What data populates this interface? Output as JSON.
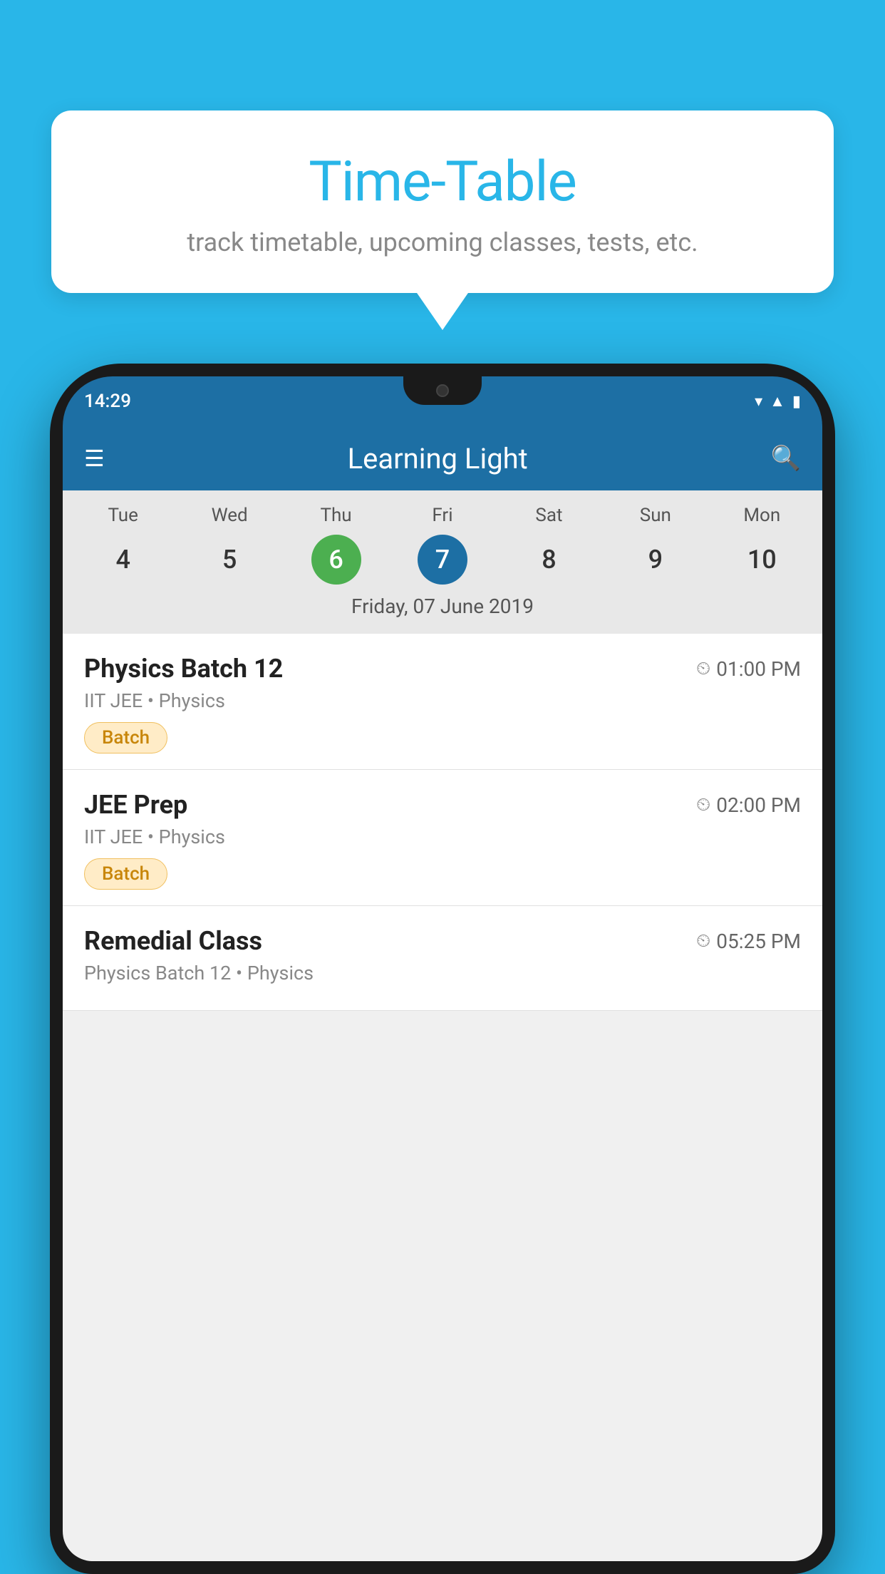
{
  "background_color": "#29b6e8",
  "tooltip": {
    "title": "Time-Table",
    "subtitle": "track timetable, upcoming classes, tests, etc."
  },
  "phone": {
    "status_bar": {
      "time": "14:29"
    },
    "app_bar": {
      "title": "Learning Light"
    },
    "calendar": {
      "days": [
        "Tue",
        "Wed",
        "Thu",
        "Fri",
        "Sat",
        "Sun",
        "Mon"
      ],
      "dates": [
        "4",
        "5",
        "6",
        "7",
        "8",
        "9",
        "10"
      ],
      "today_index": 2,
      "selected_index": 3,
      "selected_label": "Friday, 07 June 2019"
    },
    "classes": [
      {
        "name": "Physics Batch 12",
        "time": "01:00 PM",
        "meta": "IIT JEE • Physics",
        "badge": "Batch"
      },
      {
        "name": "JEE Prep",
        "time": "02:00 PM",
        "meta": "IIT JEE • Physics",
        "badge": "Batch"
      },
      {
        "name": "Remedial Class",
        "time": "05:25 PM",
        "meta": "Physics Batch 12 • Physics",
        "badge": null
      }
    ]
  }
}
